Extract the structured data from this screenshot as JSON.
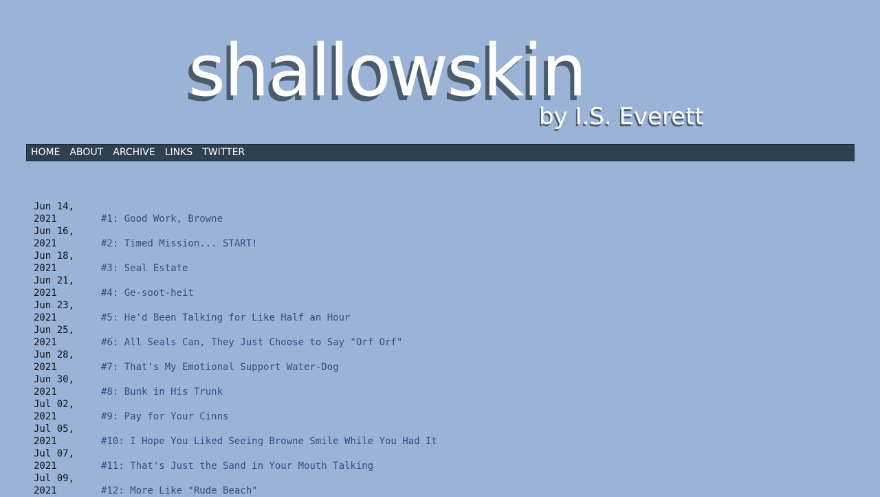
{
  "header": {
    "logo_text": "shallowskin",
    "byline": "by I.S. Everett"
  },
  "nav": {
    "items": [
      "HOME",
      "ABOUT",
      "ARCHIVE",
      "LINKS",
      "TWITTER"
    ]
  },
  "archive": [
    {
      "date": "Jun 14,\n2021",
      "title": "#1: Good Work, Browne"
    },
    {
      "date": "Jun 16,\n2021",
      "title": "#2: Timed Mission... START!"
    },
    {
      "date": "Jun 18,\n2021",
      "title": "#3: Seal Estate"
    },
    {
      "date": "Jun 21,\n2021",
      "title": "#4: Ge-soot-heit"
    },
    {
      "date": "Jun 23,\n2021",
      "title": "#5: He'd Been Talking for Like Half an Hour"
    },
    {
      "date": "Jun 25,\n2021",
      "title": "#6: All Seals Can, They Just Choose to Say \"Orf Orf\""
    },
    {
      "date": "Jun 28,\n2021",
      "title": "#7: That's My Emotional Support Water-Dog"
    },
    {
      "date": "Jun 30,\n2021",
      "title": "#8: Bunk in His Trunk"
    },
    {
      "date": "Jul 02,\n2021",
      "title": "#9: Pay for Your Cinns"
    },
    {
      "date": "Jul 05,\n2021",
      "title": "#10: I Hope You Liked Seeing Browne Smile While You Had It"
    },
    {
      "date": "Jul 07,\n2021",
      "title": "#11: That's Just the Sand in Your Mouth Talking"
    },
    {
      "date": "Jul 09,\n2021",
      "title": "#12: More Like \"Rude Beach\""
    }
  ]
}
